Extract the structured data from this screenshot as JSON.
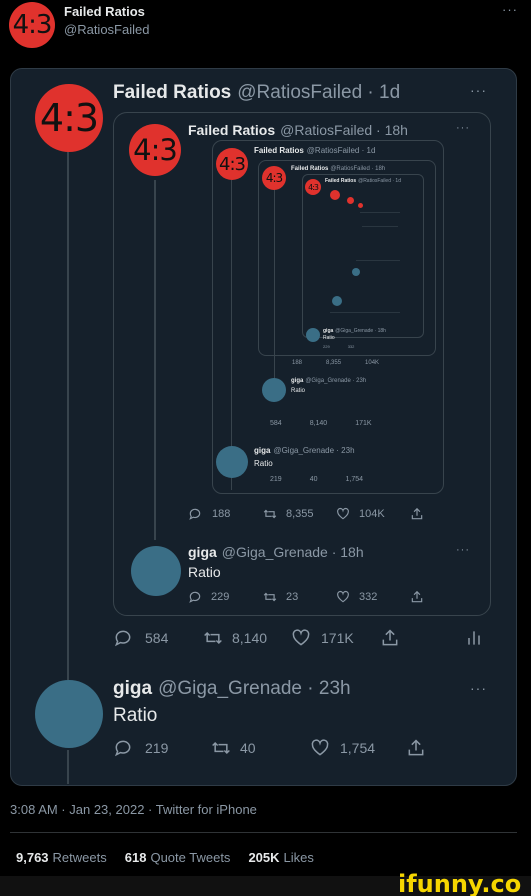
{
  "profile_header": {
    "avatar_text": "4:3",
    "name": "Failed Ratios",
    "handle": "@RatiosFailed",
    "more": "···"
  },
  "main_tweet": {
    "avatar_text": "4:3",
    "name": "Failed Ratios",
    "handle": "@RatiosFailed · 1d",
    "more": "···"
  },
  "quote_level1": {
    "avatar_text": "4:3",
    "name": "Failed Ratios",
    "handle": "@RatiosFailed · 18h",
    "more": "···"
  },
  "quote_level2": {
    "avatar_text": "4:3",
    "name": "Failed Ratios",
    "handle": "@RatiosFailed · 1d"
  },
  "quote_level3": {
    "avatar_text": "4:3",
    "name": "Failed Ratios",
    "handle": "@RatiosFailed · 18h"
  },
  "quote_level4": {
    "avatar_text": "4:3",
    "name": "Failed Ratios",
    "handle": "@RatiosFailed · 1d"
  },
  "deep_reply_a": {
    "name": "giga",
    "handle": "@Giga_Grenade · 23h",
    "text": "Ratio",
    "replies": "219",
    "retweets": "40",
    "likes": "1,754"
  },
  "deep_reply_b": {
    "name": "giga",
    "handle": "@Giga_Grenade · 18h",
    "text": "Ratio",
    "replies": "229",
    "likes": "332"
  },
  "mid_stats_a": {
    "replies": "188",
    "retweets": "8,355",
    "likes": "104K"
  },
  "mid_stats_b": {
    "replies": "584",
    "retweets": "8,140",
    "likes": "171K"
  },
  "mid_reply_a": {
    "name": "giga",
    "handle": "@Giga_Grenade · 23h",
    "text": "Ratio",
    "replies": "219",
    "retweets": "40",
    "likes": "1,754"
  },
  "inner_stats": {
    "replies": "188",
    "retweets": "8,355",
    "likes": "104K"
  },
  "inner_reply": {
    "name": "giga",
    "handle": "@Giga_Grenade · 18h",
    "text": "Ratio",
    "replies": "229",
    "retweets": "23",
    "likes": "332"
  },
  "main_stats": {
    "replies": "584",
    "retweets": "8,140",
    "likes": "171K"
  },
  "bottom_reply": {
    "name": "giga",
    "handle": "@Giga_Grenade · 23h",
    "text": "Ratio",
    "replies": "219",
    "retweets": "40",
    "likes": "1,754",
    "more": "···"
  },
  "footer": {
    "timestamp": "3:08 AM · Jan 23, 2022 · Twitter for iPhone",
    "retweets_count": "9,763",
    "retweets_label": "Retweets",
    "quotes_count": "618",
    "quotes_label": "Quote Tweets",
    "likes_count": "205K",
    "likes_label": "Likes"
  },
  "watermark": {
    "text": "ifunny.co"
  },
  "colors": {
    "background": "#000000",
    "card": "#15202b",
    "avatar_red": "#e0322d",
    "muted": "#8b98a5",
    "watermark": "#f5d500"
  }
}
